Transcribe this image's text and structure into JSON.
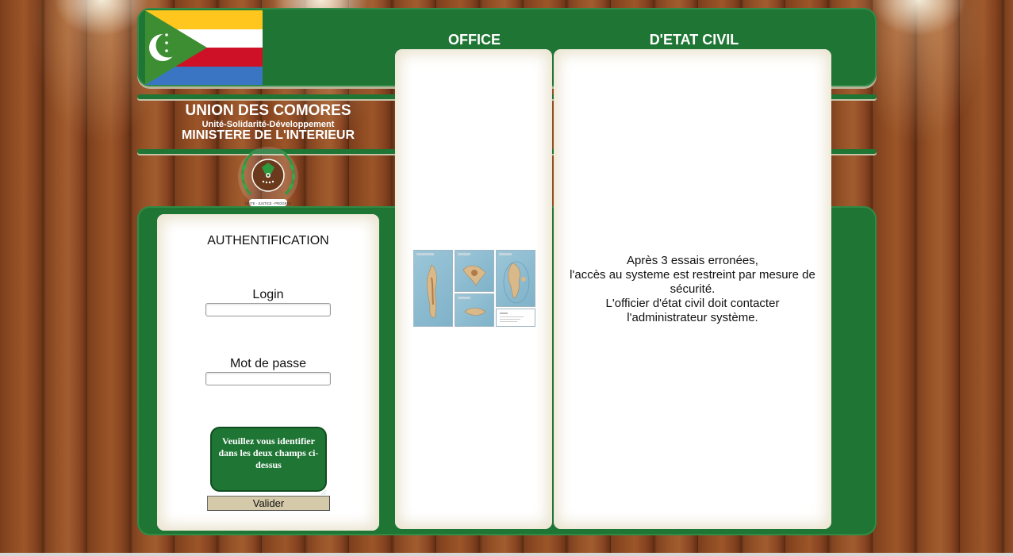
{
  "header": {
    "office_label": "OFFICE",
    "etat_civil_label": "D'ETAT CIVIL"
  },
  "identity": {
    "country": "UNION DES COMORES",
    "motto": "Unité-Solidarité-Développement",
    "ministry": "MINISTERE DE L'INTERIEUR",
    "emblem_text": "UNITE - JUSTICE - PROGRES"
  },
  "colors": {
    "brand_green": "#1f7534",
    "flag_yellow": "#ffc61e",
    "flag_white": "#ffffff",
    "flag_red": "#ce1126",
    "flag_blue": "#3a75c4",
    "button_beige": "#d4c9a8"
  },
  "auth": {
    "title": "AUTHENTIFICATION",
    "login_label": "Login",
    "login_value": "",
    "password_label": "Mot de passe",
    "password_value": "",
    "message": "Veuillez vous identifier dans les deux champs ci-dessus",
    "submit_label": "Valider"
  },
  "notice": {
    "lines": [
      "Après 3 essais erronées,",
      "l'accès au systeme est restreint par mesure de sécurité.",
      "L'officier d'état civil doit contacter",
      "l'administrateur système."
    ]
  },
  "icons": {
    "flag": "comoros-flag-icon",
    "emblem": "national-emblem-icon",
    "maps": "comoros-islands-map-icon"
  }
}
